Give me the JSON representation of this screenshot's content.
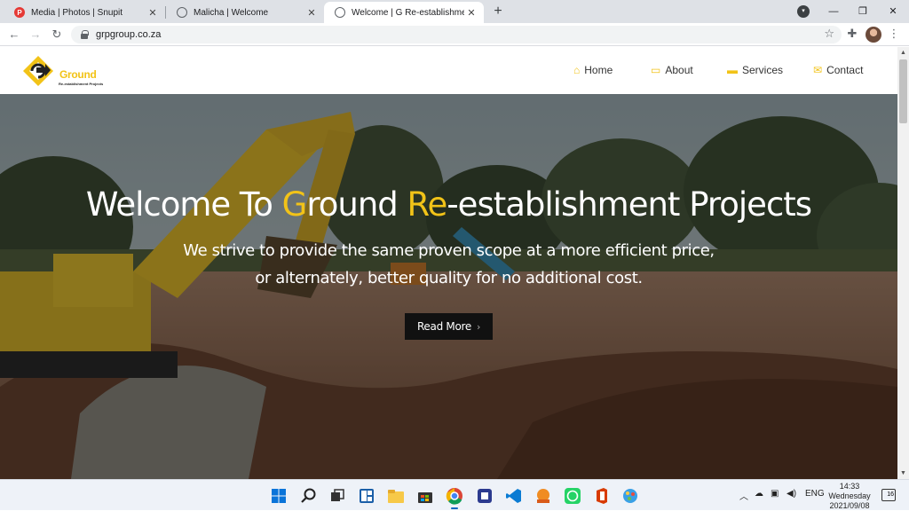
{
  "browser": {
    "tabs": [
      {
        "title": "Media | Photos | Snupit",
        "close": "✕"
      },
      {
        "title": "Malicha | Welcome",
        "close": "✕"
      },
      {
        "title": "Welcome | G Re-establishment",
        "close": "✕"
      }
    ],
    "new_tab": "+",
    "url": "grpgroup.co.za",
    "window_controls": {
      "minimize": "—",
      "restore": "❐",
      "close": "✕"
    }
  },
  "site": {
    "logo": {
      "name": "Ground",
      "tagline": "Re-establishment Projects"
    },
    "nav": [
      {
        "label": "Home",
        "icon": "home-icon"
      },
      {
        "label": "About",
        "icon": "id-card-icon"
      },
      {
        "label": "Services",
        "icon": "briefcase-icon"
      },
      {
        "label": "Contact",
        "icon": "envelope-icon"
      }
    ],
    "hero": {
      "title_pre": "Welcome To ",
      "title_g": "G",
      "title_mid": "round ",
      "title_re": "Re",
      "title_post": "-establishment Projects",
      "subtitle_line1": "We strive to provide the same proven scope at a more efficient price,",
      "subtitle_line2": "or alternately, better quality for no additional cost.",
      "cta": "Read More",
      "cta_chevron": "›"
    },
    "colors": {
      "accent": "#f2c318",
      "button": "#111111"
    }
  },
  "taskbar": {
    "tray": {
      "language": "ENG"
    },
    "clock": {
      "time": "14:33",
      "day": "Wednesday",
      "date": "2021/09/08"
    },
    "notifications": "16"
  }
}
